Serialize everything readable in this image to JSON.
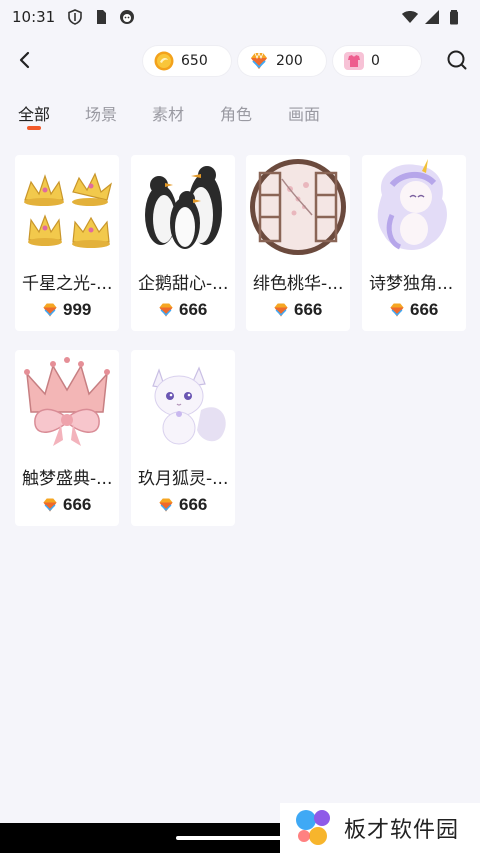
{
  "status_bar": {
    "time": "10:31",
    "left_icons": [
      "shield-icon",
      "sim-card-icon",
      "app-notification-icon"
    ],
    "right_icons": [
      "wifi-icon",
      "signal-icon",
      "battery-icon"
    ]
  },
  "top_bar": {
    "back_icon": "back-arrow-icon",
    "currencies": [
      {
        "icon": "gold-coin-icon",
        "value": "650"
      },
      {
        "icon": "gem-icon",
        "value": "200"
      },
      {
        "icon": "shirt-coupon-icon",
        "value": "0"
      }
    ],
    "search_icon": "search-icon"
  },
  "tabs": [
    {
      "label": "全部",
      "active": true
    },
    {
      "label": "场景",
      "active": false
    },
    {
      "label": "素材",
      "active": false
    },
    {
      "label": "角色",
      "active": false
    },
    {
      "label": "画面",
      "active": false
    }
  ],
  "items": [
    {
      "name": "千星之光-...",
      "price": "999",
      "image": "golden-crowns"
    },
    {
      "name": "企鹅甜心-...",
      "price": "666",
      "image": "penguins"
    },
    {
      "name": "绯色桃华-...",
      "price": "666",
      "image": "round-window-blossom"
    },
    {
      "name": "诗梦独角...",
      "price": "666",
      "image": "unicorn-girl"
    },
    {
      "name": "触梦盛典-...",
      "price": "666",
      "image": "pink-crown-bow"
    },
    {
      "name": "玖月狐灵-...",
      "price": "666",
      "image": "white-fox-spirit"
    }
  ],
  "watermark": {
    "text": "板才软件园"
  },
  "colors": {
    "background": "#f5f5fa",
    "accent": "#f25a2a",
    "tab_inactive": "#9a9aa2"
  }
}
